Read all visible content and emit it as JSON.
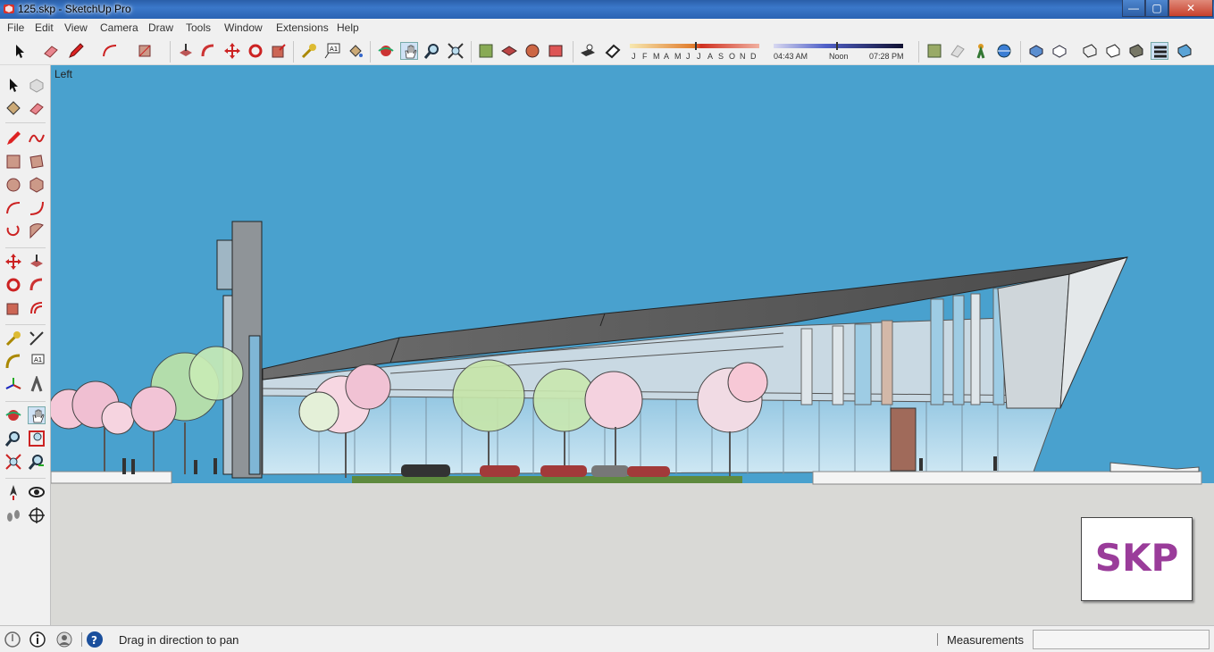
{
  "window": {
    "title": "125.skp - SketchUp Pro",
    "min": "—",
    "max": "▢",
    "close": "✕"
  },
  "menu": [
    "File",
    "Edit",
    "View",
    "Camera",
    "Draw",
    "Tools",
    "Window",
    "Extensions",
    "Help"
  ],
  "shadow": {
    "months": [
      "J",
      "F",
      "M",
      "A",
      "M",
      "J",
      "J",
      "A",
      "S",
      "O",
      "N",
      "D"
    ],
    "time_start": "04:43 AM",
    "time_mid": "Noon",
    "time_end": "07:28 PM"
  },
  "viewport": {
    "camera": "Left",
    "sky_color": "#49a1ce",
    "ground_color": "#d9d9d6"
  },
  "logo": {
    "text": "SKP",
    "color": "#9a3c9a"
  },
  "status": {
    "message": "Drag in direction to pan",
    "measurements_label": "Measurements",
    "measurements_value": ""
  },
  "icons": {
    "toolbar": [
      "select-icon",
      "eraser-icon",
      "pencil-icon",
      "arc-icon",
      "rectangle-icon",
      "push-pull-icon",
      "follow-me-icon",
      "move-icon",
      "rotate-icon",
      "scale-icon",
      "tape-measure-icon",
      "text-icon",
      "paint-bucket-icon",
      "orbit-icon",
      "pan-icon",
      "zoom-icon",
      "zoom-extents-icon",
      "3d-warehouse-icon",
      "extension-warehouse-icon",
      "layout-icon",
      "send-to-layout-icon",
      "shadows-icon",
      "fog-icon",
      "model-info-icon",
      "section-plane-icon",
      "walk-icon",
      "position-camera-icon",
      "xray-icon",
      "wireframe-icon",
      "hidden-line-icon",
      "shaded-icon",
      "shaded-textures-icon",
      "monochrome-icon"
    ]
  }
}
